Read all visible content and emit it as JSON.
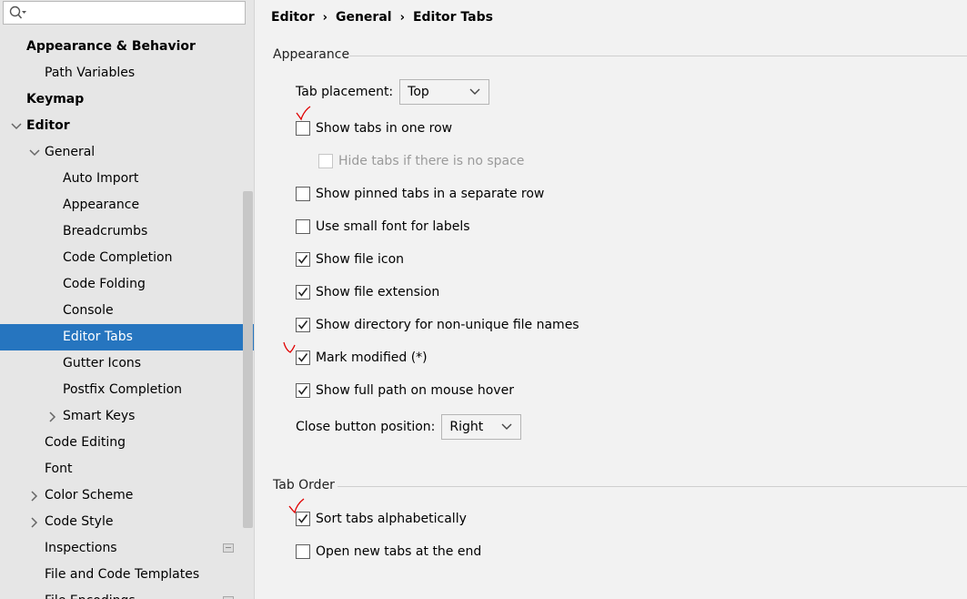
{
  "sidebar": {
    "search": {
      "value": "",
      "placeholder": ""
    },
    "items": [
      {
        "label": "Appearance & Behavior",
        "bold": true
      },
      {
        "label": "Path Variables"
      },
      {
        "label": "Keymap",
        "bold": true
      },
      {
        "label": "Editor",
        "bold": true,
        "expanded": true
      },
      {
        "label": "General",
        "expanded": true
      },
      {
        "label": "Auto Import"
      },
      {
        "label": "Appearance"
      },
      {
        "label": "Breadcrumbs"
      },
      {
        "label": "Code Completion"
      },
      {
        "label": "Code Folding"
      },
      {
        "label": "Console"
      },
      {
        "label": "Editor Tabs",
        "selected": true
      },
      {
        "label": "Gutter Icons"
      },
      {
        "label": "Postfix Completion"
      },
      {
        "label": "Smart Keys",
        "collapsed": true
      },
      {
        "label": "Code Editing"
      },
      {
        "label": "Font"
      },
      {
        "label": "Color Scheme",
        "collapsed": true
      },
      {
        "label": "Code Style",
        "collapsed": true
      },
      {
        "label": "Inspections"
      },
      {
        "label": "File and Code Templates"
      },
      {
        "label": "File Encodings"
      }
    ]
  },
  "breadcrumb": [
    "Editor",
    "General",
    "Editor Tabs"
  ],
  "appearance": {
    "title": "Appearance",
    "tab_placement_label": "Tab placement:",
    "tab_placement_value": "Top",
    "show_tabs_one_row": {
      "label": "Show tabs in one row",
      "checked": false
    },
    "hide_tabs_no_space": {
      "label": "Hide tabs if there is no space",
      "checked": false,
      "disabled": true
    },
    "show_pinned_separate": {
      "label": "Show pinned tabs in a separate row",
      "checked": false
    },
    "small_font": {
      "label": "Use small font for labels",
      "checked": false
    },
    "show_file_icon": {
      "label": "Show file icon",
      "checked": true
    },
    "show_file_extension": {
      "label": "Show file extension",
      "checked": true
    },
    "show_directory": {
      "label": "Show directory for non-unique file names",
      "checked": true
    },
    "mark_modified": {
      "label": "Mark modified (*)",
      "checked": true
    },
    "show_full_path": {
      "label": "Show full path on mouse hover",
      "checked": true
    },
    "close_button_label": "Close button position:",
    "close_button_value": "Right"
  },
  "tab_order": {
    "title": "Tab Order",
    "sort_alpha": {
      "label": "Sort tabs alphabetically",
      "checked": true
    },
    "open_at_end": {
      "label": "Open new tabs at the end",
      "checked": false
    }
  },
  "colors": {
    "selection": "#2675bf",
    "annotation": "#e00000"
  }
}
